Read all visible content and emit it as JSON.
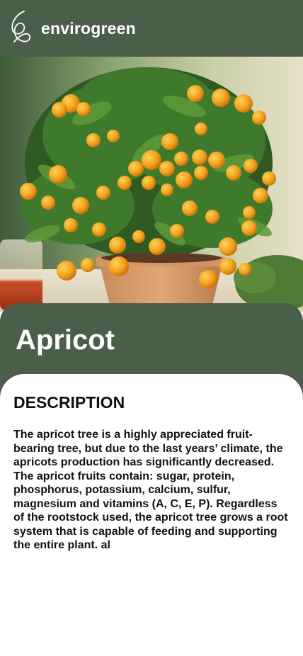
{
  "header": {
    "brand_name": "envirogreen",
    "logo_icon": "leaf-logo-icon"
  },
  "hero": {
    "image_subject": "potted-citrus-tree-photo"
  },
  "plant": {
    "name": "Apricot"
  },
  "content": {
    "section_heading": "DESCRIPTION",
    "description": "The apricot tree is a highly appreciated fruit-bearing tree, but due to the last years’ climate, the apricots production has significantly decreased. The apricot fruits contain: sugar, protein, phosphorus, potassium, calcium, sulfur, magnesium and vitamins (A, C, E, P). Regardless of the rootstock used, the apricot tree grows a root system that is capable of feeding and supporting the entire plant. al"
  },
  "colors": {
    "primary": "#4a5e4a",
    "background": "#ffffff",
    "text": "#111111",
    "fruit": "#f2a21a"
  }
}
